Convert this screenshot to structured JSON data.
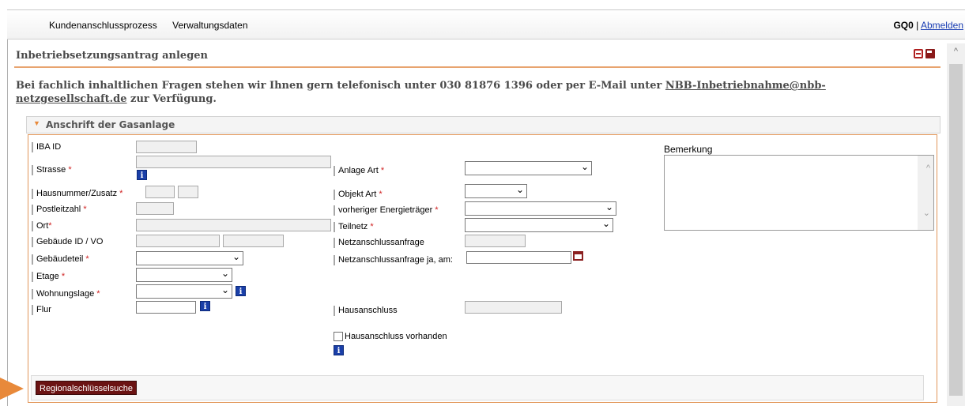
{
  "nav": {
    "items": [
      "Kundenanschlussprozess",
      "Verwaltungsdaten"
    ]
  },
  "user": {
    "name": "GQ0",
    "separator": "|",
    "logout": "Abmelden"
  },
  "page": {
    "title": "Inbetriebsetzungsantrag anlegen",
    "info_prefix": "Bei fachlich inhaltlichen Fragen stehen wir Ihnen gern telefonisch unter 030 81876 1396 oder per E-Mail unter ",
    "info_email": "NBB-Inbetriebnahme@nbb-netzgesellschaft.de",
    "info_suffix": " zur Verfügung."
  },
  "section": {
    "title": "Anschrift der Gasanlage",
    "labels": {
      "iba_id": "IBA ID",
      "strasse": "Strasse",
      "hausnummer": "Hausnummer/Zusatz",
      "postleitzahl": "Postleitzahl",
      "ort": "Ort",
      "gebaeude_id": "Gebäude ID / VO",
      "gebaeudeteil": "Gebäudeteil",
      "etage": "Etage",
      "wohnungslage": "Wohnungslage",
      "flur": "Flur",
      "anlage_art": "Anlage Art",
      "objekt_art": "Objekt Art",
      "vorheriger_energietraeger": "vorheriger Energieträger",
      "teilnetz": "Teilnetz",
      "netzanschlussanfrage": "Netzanschlussanfrage",
      "netzanschlussanfrage_am": "Netzanschlussanfrage ja, am:",
      "hausanschluss": "Hausanschluss",
      "hausanschluss_vorhanden": "Hausanschluss vorhanden",
      "bemerkung": "Bemerkung"
    },
    "required_mark": "*",
    "button": "Regionalschlüsselsuche"
  },
  "colors": {
    "accent": "#e8893a",
    "button_bg": "#6b1313",
    "info_icon": "#1a3fa8",
    "required": "#d02020"
  }
}
